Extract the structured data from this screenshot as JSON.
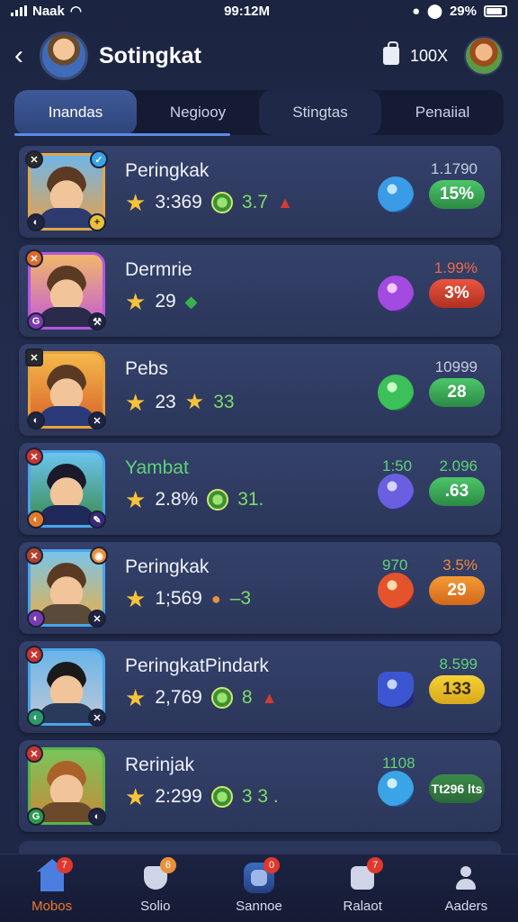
{
  "status_bar": {
    "carrier": "Naak",
    "time": "99:12M",
    "battery": "29%"
  },
  "header": {
    "title": "Sotingkat",
    "currency": "100X"
  },
  "tabs": [
    {
      "label": "Inandas"
    },
    {
      "label": "Negiooy"
    },
    {
      "label": "Stingtas"
    },
    {
      "label": "Penaiial"
    }
  ],
  "rows": [
    {
      "name": "Peringkak",
      "score": "3:369",
      "secondary": "3.7",
      "stat_a": "",
      "stat_b": "1.1790",
      "pill": "15%",
      "gem": "blue",
      "pill_color": "green"
    },
    {
      "name": "Dermrie",
      "score": "29",
      "secondary": "",
      "stat_a": "",
      "stat_b": "1.99%",
      "pill": "3%",
      "gem": "purple",
      "pill_color": "red"
    },
    {
      "name": "Pebs",
      "score": "23",
      "secondary": "33",
      "stat_a": "",
      "stat_b": "10999",
      "pill": "28",
      "gem": "green",
      "pill_color": "green"
    },
    {
      "name": "Yambat",
      "score": "2.8%",
      "secondary": "31.",
      "stat_a": "1:50",
      "stat_b": "2.096",
      "pill": ".63",
      "gem": "indigo",
      "pill_color": "green"
    },
    {
      "name": "Peringkak",
      "score": "1;569",
      "secondary": "–3",
      "stat_a": "970",
      "stat_b": "3.5%",
      "pill": "29",
      "gem": "red",
      "pill_color": "orange"
    },
    {
      "name": "PeringkatPindark",
      "score": "2,769",
      "secondary": "8",
      "stat_a": "",
      "stat_b": "8.599",
      "pill": "133",
      "gem": "royal",
      "pill_color": "yellow"
    },
    {
      "name": "Rerinjak",
      "score": "2:299",
      "secondary": "3 3 .",
      "stat_a": "1108",
      "stat_b": "",
      "pill": "Tt296 lts",
      "gem": "sky",
      "pill_color": "darkgreen"
    }
  ],
  "bottom_nav": [
    {
      "label": "Mobos",
      "badge": "7"
    },
    {
      "label": "Solio",
      "badge": "6"
    },
    {
      "label": "Sannoe",
      "badge": "0"
    },
    {
      "label": "Ralaot",
      "badge": "7"
    },
    {
      "label": "Aaders",
      "badge": ""
    }
  ]
}
